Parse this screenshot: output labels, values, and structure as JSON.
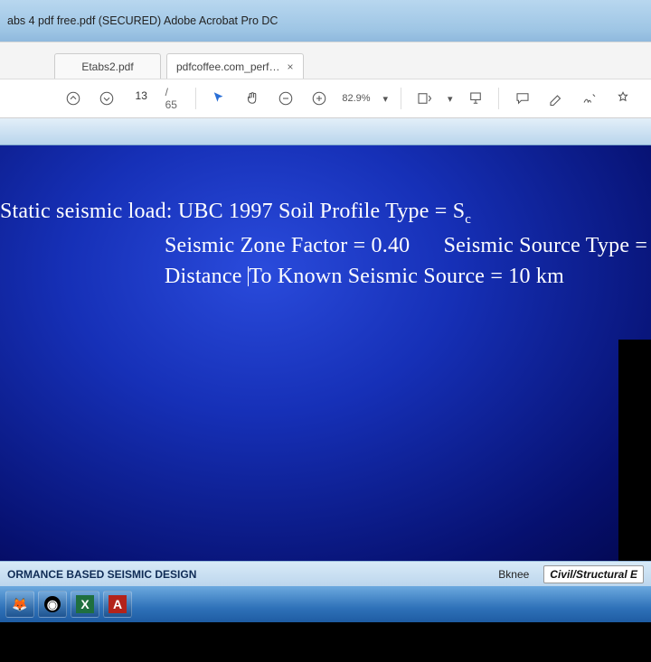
{
  "titlebar": {
    "text": "abs 4 pdf free.pdf (SECURED)   Adobe Acrobat Pro DC"
  },
  "tabs": {
    "inactive": {
      "label": "Etabs2.pdf"
    },
    "active": {
      "label": "pdfcoffee.com_perf…",
      "close": "×"
    }
  },
  "toolbar": {
    "page_current": "13",
    "page_total_prefix": "/",
    "page_total": "65",
    "zoom": "82.9%",
    "zoom_caret": "▾"
  },
  "slide": {
    "line1_a": "Static seismic load: UBC 1997 Soil Profile Type = S",
    "line1_sub": "c",
    "line2_a": "Seismic Zone Factor = 0.40",
    "line2_b": "Seismic Source Type = A",
    "line3_a": "Distance ",
    "line3_b": "To Known Seismic Source = 10 km"
  },
  "status": {
    "left": "ORMANCE BASED SEISMIC DESIGN",
    "mid": "Bknee",
    "right": "Civil/Structural E"
  },
  "taskbar": {
    "firefox": "🦊",
    "github": "◉",
    "excel": "X",
    "reader": "A"
  }
}
